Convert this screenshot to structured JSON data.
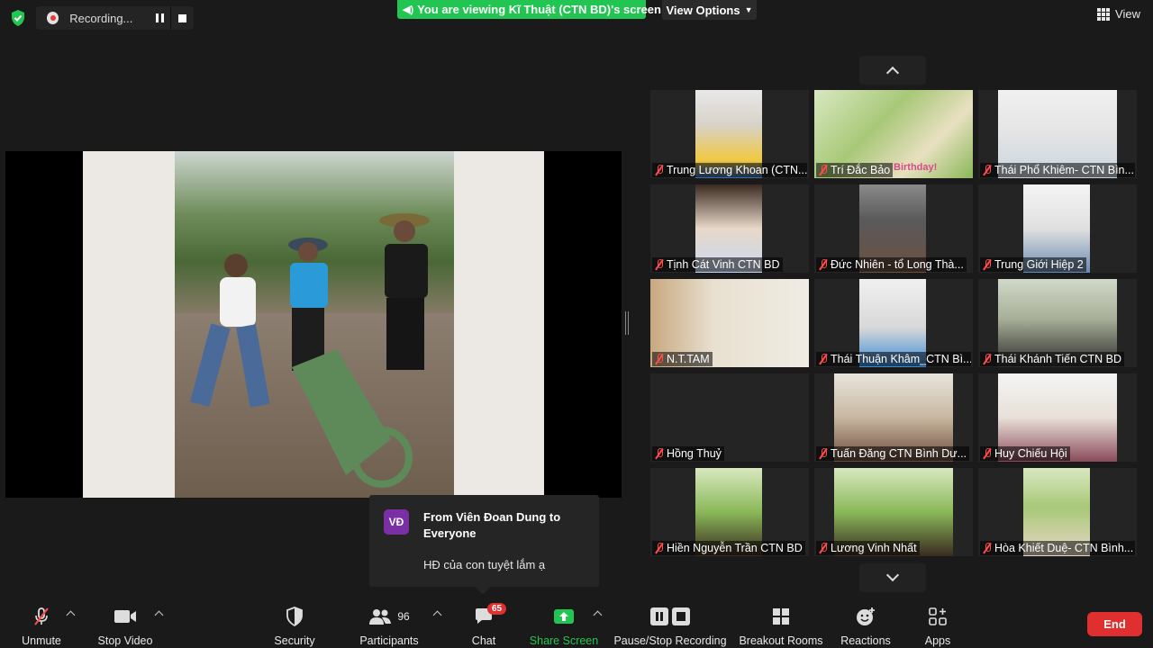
{
  "recording": {
    "label": "Recording..."
  },
  "banner": {
    "viewing_text": "You are viewing Kĩ Thuật (CTN BD)'s screen",
    "view_options": "View Options"
  },
  "view_button": "View",
  "gallery": {
    "tiles": [
      {
        "name": "Trung Lương Khoan (CTN...",
        "muted": true
      },
      {
        "name": "Trí Đắc Bảo",
        "muted": true,
        "overlay_text": "Birthday!"
      },
      {
        "name": "Thái Phổ Khiêm- CTN Bìn...",
        "muted": true
      },
      {
        "name": "Tịnh Cát Vinh CTN BD",
        "muted": true
      },
      {
        "name": "Đức Nhiên - tổ Long Thà...",
        "muted": true
      },
      {
        "name": "Trung Giới Hiệp 2",
        "muted": true
      },
      {
        "name": "N.T.TAM",
        "muted": true
      },
      {
        "name": "Thái Thuận Khâm_CTN Bì...",
        "muted": true
      },
      {
        "name": "Thái Khánh Tiến CTN BD",
        "muted": true
      },
      {
        "name": "Hồng Thuỷ",
        "muted": true
      },
      {
        "name": "Tuấn Đăng CTN Bình Dư...",
        "muted": true
      },
      {
        "name": "Huy Chiếu Hội",
        "muted": true
      },
      {
        "name": "Hiền Nguyễn Trần CTN BD",
        "muted": true
      },
      {
        "name": "Lương Vinh Nhất",
        "muted": true
      },
      {
        "name": "Hòa Khiết Duệ- CTN Bình...",
        "muted": true
      }
    ]
  },
  "chat_popup": {
    "avatar_initials": "VĐ",
    "from": "From Viên Đoan Dung to Everyone",
    "message": "HĐ của con tuyệt lắm ạ"
  },
  "toolbar": {
    "unmute": "Unmute",
    "stop_video": "Stop Video",
    "security": "Security",
    "participants": "Participants",
    "participants_count": "96",
    "chat": "Chat",
    "chat_badge": "65",
    "share_screen": "Share Screen",
    "pause_stop_recording": "Pause/Stop Recording",
    "breakout_rooms": "Breakout Rooms",
    "reactions": "Reactions",
    "apps": "Apps",
    "end": "End"
  },
  "colors": {
    "green": "#23c552",
    "red": "#e02f2f",
    "avatar_purple": "#7b2fa5"
  }
}
